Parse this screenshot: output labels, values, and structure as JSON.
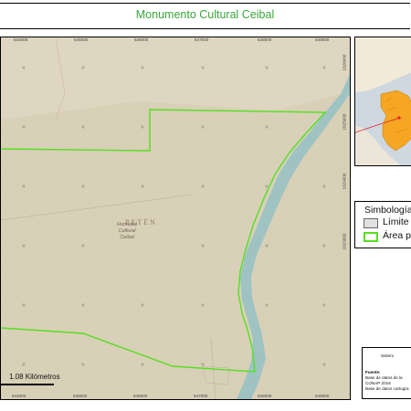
{
  "title": "Monumento Cultural Ceibal",
  "map": {
    "region_label": "PETÉN",
    "place_label_line1": "Humedal",
    "place_label_line2": "Cultural",
    "place_label_line3": "Ceibal",
    "x_ticks": [
      "544000",
      "545000",
      "546000",
      "547000",
      "548000",
      "549000"
    ],
    "x_ticks_bottom": [
      "544000",
      "545000",
      "546000",
      "547000",
      "548000",
      "549000"
    ],
    "y_ticks": [
      "1826000",
      "1825000",
      "1824000",
      "1823000"
    ],
    "scale_label": "1.08 Kilómetros",
    "colors": {
      "terrain": "#d9d0b8",
      "river": "#9fc3c3",
      "protected_area_outline": "#55e021",
      "grid_marker": "#8c8577"
    }
  },
  "inset": {
    "colors": {
      "water": "#cfd7e0",
      "land": "#f2ead8",
      "highlight": "#f5a623",
      "pointer": "#e02424"
    }
  },
  "legend": {
    "title": "Simbología",
    "items": [
      {
        "label": "Límite",
        "swatch_fill": "#e0e0e0",
        "swatch_border": "#666666"
      },
      {
        "label": "Área pr",
        "swatch_fill": "#ffffff",
        "swatch_border": "#55e021"
      }
    ]
  },
  "info": {
    "line1": "Sistem",
    "line2": "Fuente:",
    "line3": "Base de datos de la",
    "line4": "CONAP 2016",
    "line5": "Base de datos cartogra"
  }
}
